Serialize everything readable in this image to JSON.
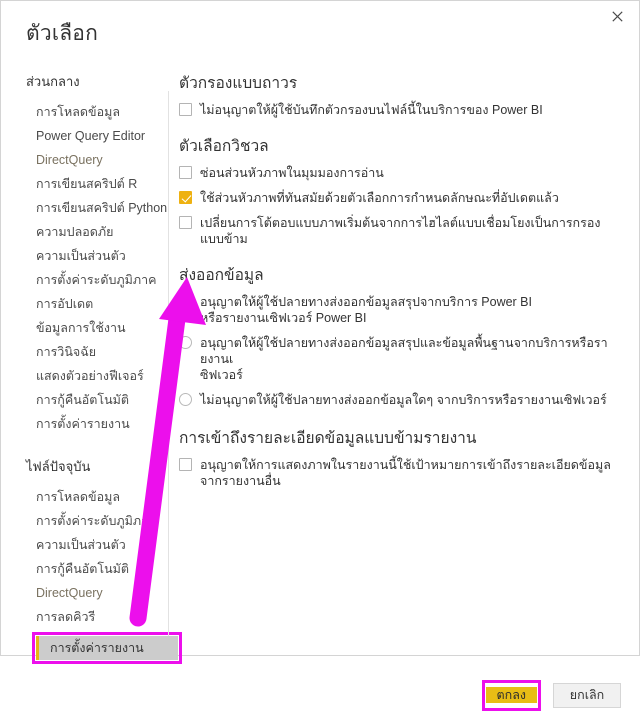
{
  "window": {
    "title": "ตัวเลือก",
    "close_icon": "close-icon"
  },
  "sidebar": {
    "groups": [
      {
        "title": "ส่วนกลาง",
        "items": [
          {
            "label": "การโหลดข้อมูล",
            "state": "normal"
          },
          {
            "label": "Power Query Editor",
            "state": "normal"
          },
          {
            "label": "DirectQuery",
            "state": "muted"
          },
          {
            "label": "การเขียนสคริปต์ R",
            "state": "normal"
          },
          {
            "label": "การเขียนสคริปต์ Python",
            "state": "normal"
          },
          {
            "label": "ความปลอดภัย",
            "state": "normal"
          },
          {
            "label": "ความเป็นส่วนตัว",
            "state": "normal"
          },
          {
            "label": "การตั้งค่าระดับภูมิภาค",
            "state": "normal"
          },
          {
            "label": "การอัปเดต",
            "state": "normal"
          },
          {
            "label": "ข้อมูลการใช้งาน",
            "state": "normal"
          },
          {
            "label": "การวินิจฉัย",
            "state": "normal"
          },
          {
            "label": "แสดงตัวอย่างฟีเจอร์",
            "state": "normal"
          },
          {
            "label": "การกู้คืนอัตโนมัติ",
            "state": "normal"
          },
          {
            "label": "การตั้งค่ารายงาน",
            "state": "normal"
          }
        ]
      },
      {
        "title": "ไฟล์ปัจจุบัน",
        "items": [
          {
            "label": "การโหลดข้อมูล",
            "state": "normal"
          },
          {
            "label": "การตั้งค่าระดับภูมิภาค",
            "state": "normal"
          },
          {
            "label": "ความเป็นส่วนตัว",
            "state": "normal"
          },
          {
            "label": "การกู้คืนอัตโนมัติ",
            "state": "normal"
          },
          {
            "label": "DirectQuery",
            "state": "muted"
          },
          {
            "label": "การลดคิวรี",
            "state": "normal"
          }
        ],
        "selected_item": {
          "label": "การตั้งค่ารายงาน",
          "state": "selected"
        }
      }
    ]
  },
  "content": {
    "sections": [
      {
        "heading": "ตัวกรองแบบถาวร",
        "type": "checkbox",
        "options": [
          {
            "label": "ไม่อนุญาตให้ผู้ใช้บันทึกตัวกรองบนไฟล์นี้ในบริการของ Power BI",
            "checked": false
          }
        ]
      },
      {
        "heading": "ตัวเลือกวิชวล",
        "type": "checkbox",
        "options": [
          {
            "label": "ซ่อนส่วนหัวภาพในมุมมองการอ่าน",
            "checked": false
          },
          {
            "label": "ใช้ส่วนหัวภาพที่ทันสมัยด้วยตัวเลือกการกำหนดลักษณะที่อัปเดตแล้ว",
            "checked": true
          },
          {
            "label": "เปลี่ยนการโต้ตอบแบบภาพเริ่มต้นจากการไฮไลต์แบบเชื่อมโยงเป็นการกรองแบบข้าม",
            "checked": false
          }
        ]
      },
      {
        "heading": "ส่งออกข้อมูล",
        "type": "radio",
        "options": [
          {
            "label": "อนุญาตให้ผู้ใช้ปลายทางส่งออกข้อมูลสรุปจากบริการ Power BI",
            "label_line2": "หรือรายงานเซิฟเวอร์ Power BI",
            "checked": true
          },
          {
            "label": "อนุญาตให้ผู้ใช้ปลายทางส่งออกข้อมูลสรุปและข้อมูลพื้นฐานจากบริการหรือรายงานเ",
            "label_line2": "ซิฟเวอร์",
            "checked": false
          },
          {
            "label": "ไม่อนุญาตให้ผู้ใช้ปลายทางส่งออกข้อมูลใดๆ จากบริการหรือรายงานเซิฟเวอร์",
            "checked": false
          }
        ]
      },
      {
        "heading": "การเข้าถึงรายละเอียดข้อมูลแบบข้ามรายงาน",
        "type": "checkbox",
        "options": [
          {
            "label": "อนุญาตให้การแสดงภาพในรายงานนี้ใช้เป้าหมายการเข้าถึงรายละเอียดข้อมูลจากรายงานอื่น",
            "checked": false
          }
        ]
      }
    ]
  },
  "footer": {
    "ok_label": "ตกลง",
    "cancel_label": "ยกเลิก"
  },
  "annotation": {
    "highlight_color": "#ec0fec",
    "accent_color": "#e8bd15",
    "arrow_name": "callout-arrow"
  }
}
